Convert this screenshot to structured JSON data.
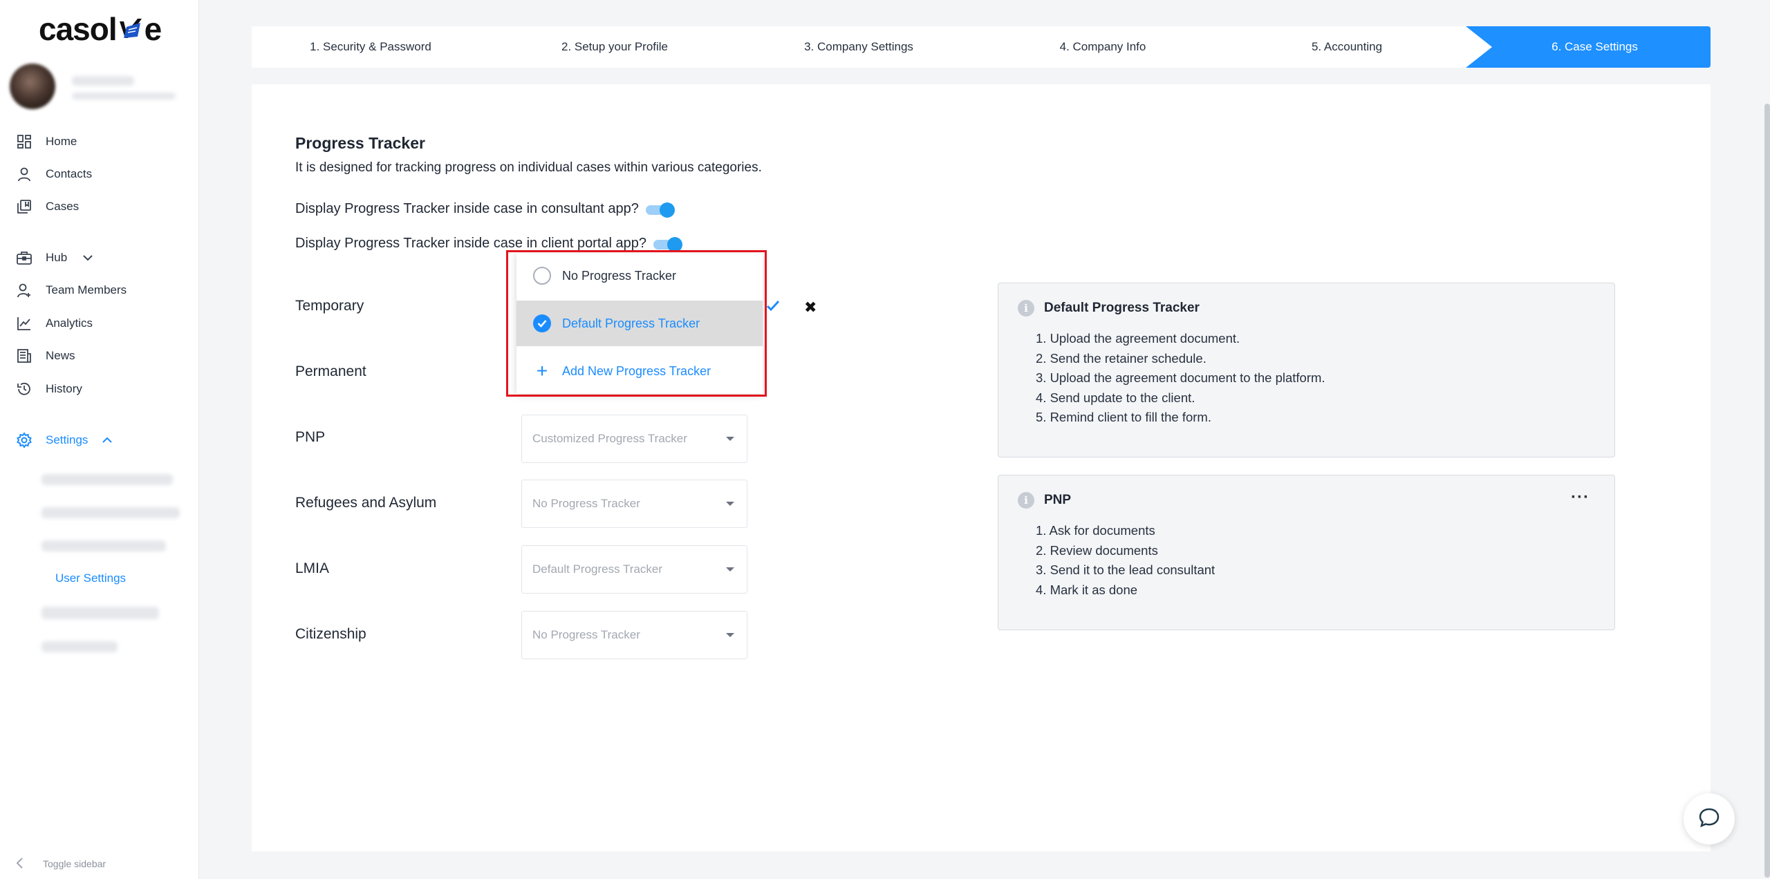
{
  "app": {
    "logo_text_left": "casol",
    "logo_text_right": "e"
  },
  "sidebar": {
    "items": [
      {
        "label": "Home",
        "icon": "home-grid-icon"
      },
      {
        "label": "Contacts",
        "icon": "person-icon"
      },
      {
        "label": "Cases",
        "icon": "cases-icon"
      },
      {
        "label": "Hub",
        "icon": "briefcase-icon"
      },
      {
        "label": "Team Members",
        "icon": "team-icon"
      },
      {
        "label": "Analytics",
        "icon": "chart-icon"
      },
      {
        "label": "News",
        "icon": "news-icon"
      },
      {
        "label": "History",
        "icon": "history-icon"
      },
      {
        "label": "Settings",
        "icon": "gear-icon"
      }
    ],
    "settings_sub_active": "User Settings",
    "toggle_label": "Toggle sidebar"
  },
  "stepper": {
    "steps": [
      "1. Security & Password",
      "2. Setup your Profile",
      "3. Company Settings",
      "4. Company Info",
      "5. Accounting",
      "6. Case Settings"
    ],
    "active_color": "#1e90ff"
  },
  "main": {
    "title": "Progress Tracker",
    "description": "It is designed for tracking progress on individual cases within various categories.",
    "toggle_consultant": "Display Progress Tracker inside case in consultant app?",
    "toggle_client": "Display Progress Tracker inside case in client portal app?",
    "rows": [
      {
        "label": "Temporary",
        "value": ""
      },
      {
        "label": "Permanent",
        "value": ""
      },
      {
        "label": "PNP",
        "value": "Customized Progress Tracker"
      },
      {
        "label": "Refugees and Asylum",
        "value": "No Progress Tracker"
      },
      {
        "label": "LMIA",
        "value": "Default Progress Tracker"
      },
      {
        "label": "Citizenship",
        "value": "No Progress Tracker"
      }
    ],
    "dropdown": {
      "options": [
        "No Progress Tracker",
        "Default Progress Tracker",
        "Add New Progress Tracker"
      ],
      "selected": "Default Progress Tracker"
    }
  },
  "panels": [
    {
      "title": "Default Progress Tracker",
      "items": [
        "1. Upload the agreement document.",
        "2. Send the retainer schedule.",
        "3. Upload the agreement document to the platform.",
        "4. Send update to the client.",
        "5. Remind client to fill the form."
      ]
    },
    {
      "title": "PNP",
      "more": "···",
      "items": [
        "1. Ask for documents",
        "2. Review documents",
        "3. Send it to the lead consultant",
        "4. Mark it as done"
      ]
    }
  ],
  "colors": {
    "accent": "#1a8cff",
    "highlight_border": "#e3141e"
  }
}
